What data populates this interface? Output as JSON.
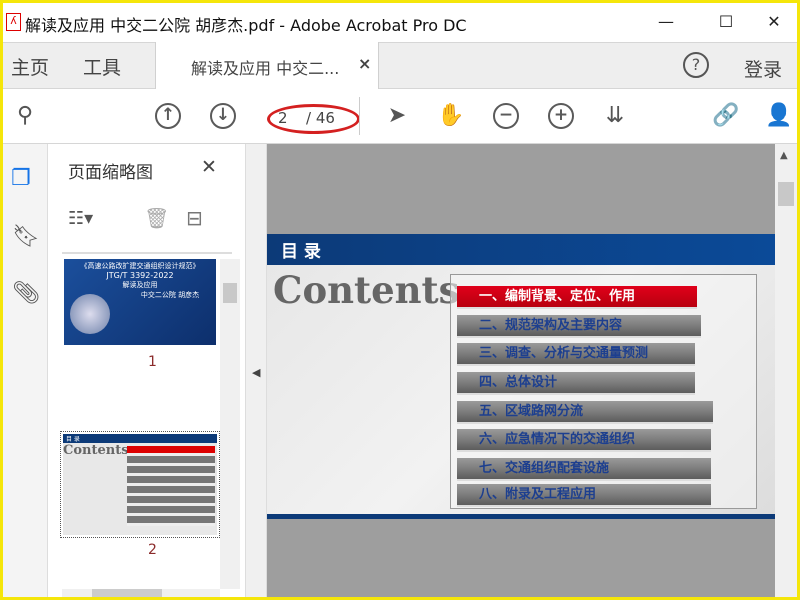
{
  "window": {
    "title": "解读及应用 中交二公院 胡彦杰.pdf - Adobe Acrobat Pro DC",
    "minimize": "—",
    "maximize": "☐",
    "close": "✕"
  },
  "tabs": {
    "home": "主页",
    "tools": "工具",
    "document": "解读及应用 中交二...",
    "close": "×",
    "login": "登录",
    "help": "?"
  },
  "toolbar": {
    "current_page": "2",
    "total_pages": "/ 46"
  },
  "thumbnails": {
    "title": "页面缩略图",
    "close": "✕",
    "pages": [
      {
        "number": "1",
        "title": "《高速公路改扩建交通组织设计规范》",
        "code": "JTG/T 3392-2022",
        "subtitle": "解读及应用",
        "author": "中交二公院 胡彦杰"
      },
      {
        "number": "2",
        "header": "目 录",
        "heading": "Contents"
      }
    ]
  },
  "slide": {
    "header": "目 录",
    "heading": "Contents",
    "toc": [
      "一、编制背景、定位、作用",
      "二、规范架构及主要内容",
      "三、调查、分析与交通量预测",
      "四、总体设计",
      "五、区域路网分流",
      "六、应急情况下的交通组织",
      "七、交通组织配套设施",
      "八、附录及工程应用"
    ]
  },
  "colors": {
    "accent": "#0b4a98",
    "active_toc": "#d50016",
    "highlight_ellipse": "#d42020",
    "hand_tool": "#1473e6"
  }
}
